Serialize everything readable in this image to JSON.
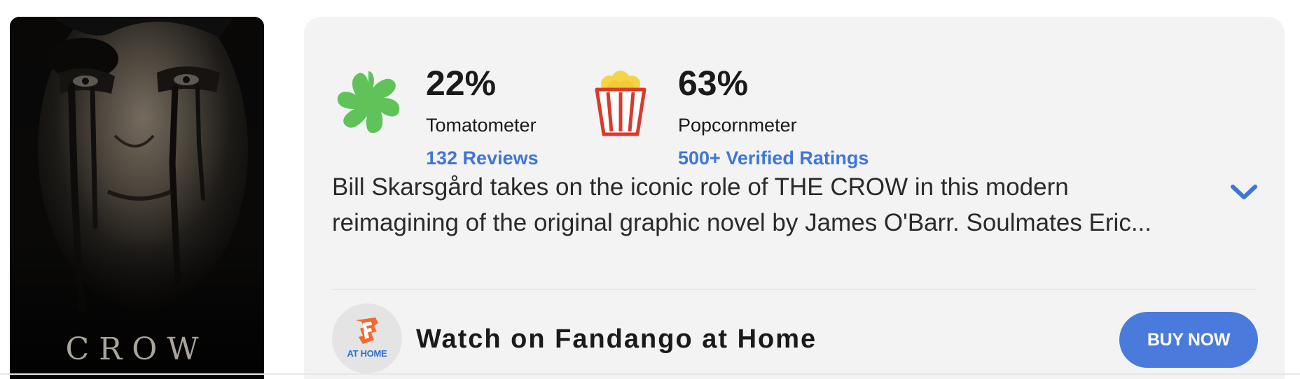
{
  "poster": {
    "title_text": "CROW",
    "alt": "poster-image"
  },
  "scores": {
    "tomatometer": {
      "value": "22%",
      "label": "Tomatometer",
      "link": "132 Reviews",
      "icon": "rotten-splat-icon",
      "color": "#5fc35a"
    },
    "popcornmeter": {
      "value": "63%",
      "label": "Popcornmeter",
      "link": "500+ Verified Ratings",
      "icon": "popcorn-bucket-icon",
      "color": "#d93a2b"
    }
  },
  "synopsis": {
    "text": "Bill Skarsgård takes on the iconic role of THE CROW in this modern reimagining of the original graphic novel by James O'Barr. Soulmates Eric...",
    "expand_icon": "chevron-down-icon"
  },
  "streaming": {
    "logo_caption": "AT HOME",
    "logo_icon": "fandango-f-icon",
    "label": "Watch on Fandango at Home",
    "button_label": "BUY NOW"
  },
  "colors": {
    "link": "#3f76d6",
    "button": "#4a7bdc",
    "card_bg": "#f3f3f3",
    "fandango_orange": "#f26a2e"
  }
}
